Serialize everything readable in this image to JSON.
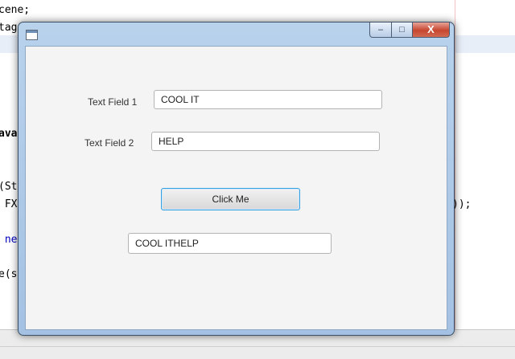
{
  "editor": {
    "lines": [
      "cene;",
      "tag",
      "ava",
      "(St",
      " FX",
      " ne",
      "e(s",
      "));"
    ]
  },
  "window": {
    "title": "",
    "controls": {
      "minimize": "–",
      "maximize": "□",
      "close": "X"
    }
  },
  "form": {
    "field1_label": "Text Field 1",
    "field1_value": "COOL IT",
    "field2_label": "Text Field 2",
    "field2_value": "HELP",
    "button_label": "Click Me",
    "output_value": "COOL ITHELP"
  }
}
